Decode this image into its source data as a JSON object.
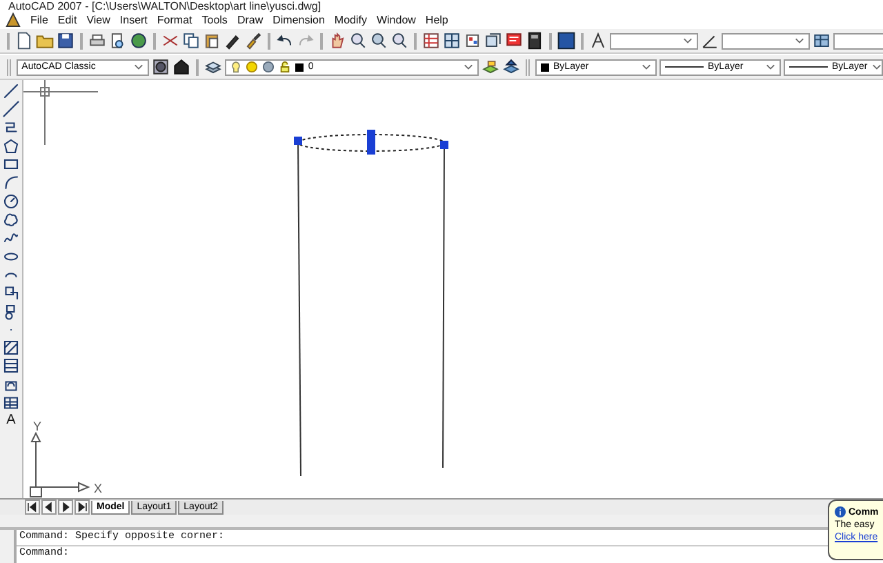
{
  "window": {
    "title": "AutoCAD 2007 - [C:\\Users\\WALTON\\Desktop\\art line\\yusci.dwg]"
  },
  "menu_bar": {
    "items": [
      "File",
      "Edit",
      "View",
      "Insert",
      "Format",
      "Tools",
      "Draw",
      "Dimension",
      "Modify",
      "Window",
      "Help"
    ]
  },
  "properties_toolbar": {
    "workspace": "AutoCAD Classic",
    "layer": "0",
    "color_setting": "ByLayer",
    "linetype": "ByLayer",
    "lineweight": "ByLayer"
  },
  "draw_toolbar": {
    "text_tool_glyph": "A"
  },
  "canvas": {
    "ucs_y_label": "Y",
    "ucs_x_label": "X"
  },
  "layout_tabs": [
    {
      "label": "Model",
      "selected": true
    },
    {
      "label": "Layout1",
      "selected": false
    },
    {
      "label": "Layout2",
      "selected": false
    }
  ],
  "command_window": {
    "lines": [
      "Command: Specify opposite corner:",
      "Command:"
    ]
  },
  "notification": {
    "title": "Comm",
    "text": "The easy",
    "link": "Click here"
  }
}
